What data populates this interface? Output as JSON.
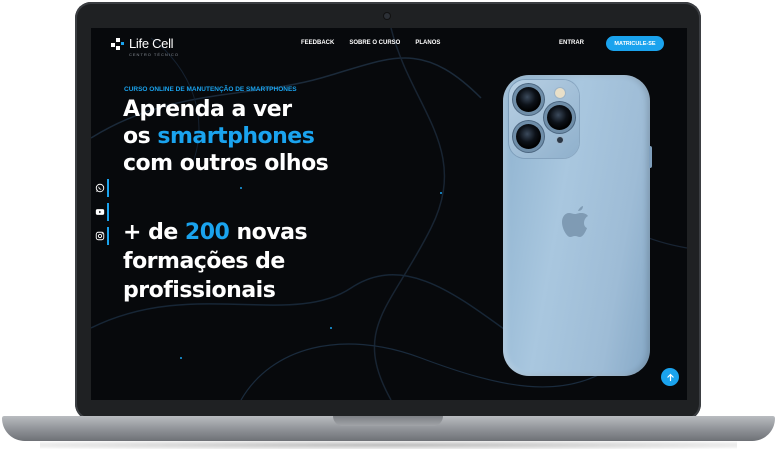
{
  "brand": {
    "name": "Life Cell",
    "tagline": "CENTRO TÉCNICO"
  },
  "nav": {
    "items": [
      "FEEDBACK",
      "SOBRE O CURSO",
      "PLANOS"
    ],
    "login_label": "ENTRAR",
    "cta_label": "MATRICULE-SE"
  },
  "hero": {
    "eyebrow": "CURSO ONLINE DE MANUTENÇÃO DE SMARTPHONES",
    "headline": {
      "line1": "Aprenda a ver",
      "line2_prefix": "os ",
      "line2_accent": "smartphones",
      "line3": "com outros olhos"
    },
    "stat": {
      "prefix": "+ de ",
      "number": "200",
      "suffix": " novas",
      "line2": "formações de",
      "line3": "profissionais"
    }
  },
  "social": {
    "icons": [
      "whatsapp-icon",
      "youtube-icon",
      "instagram-icon"
    ]
  },
  "colors": {
    "accent": "#1aa3ee",
    "background": "#07090c",
    "text": "#ffffff"
  }
}
